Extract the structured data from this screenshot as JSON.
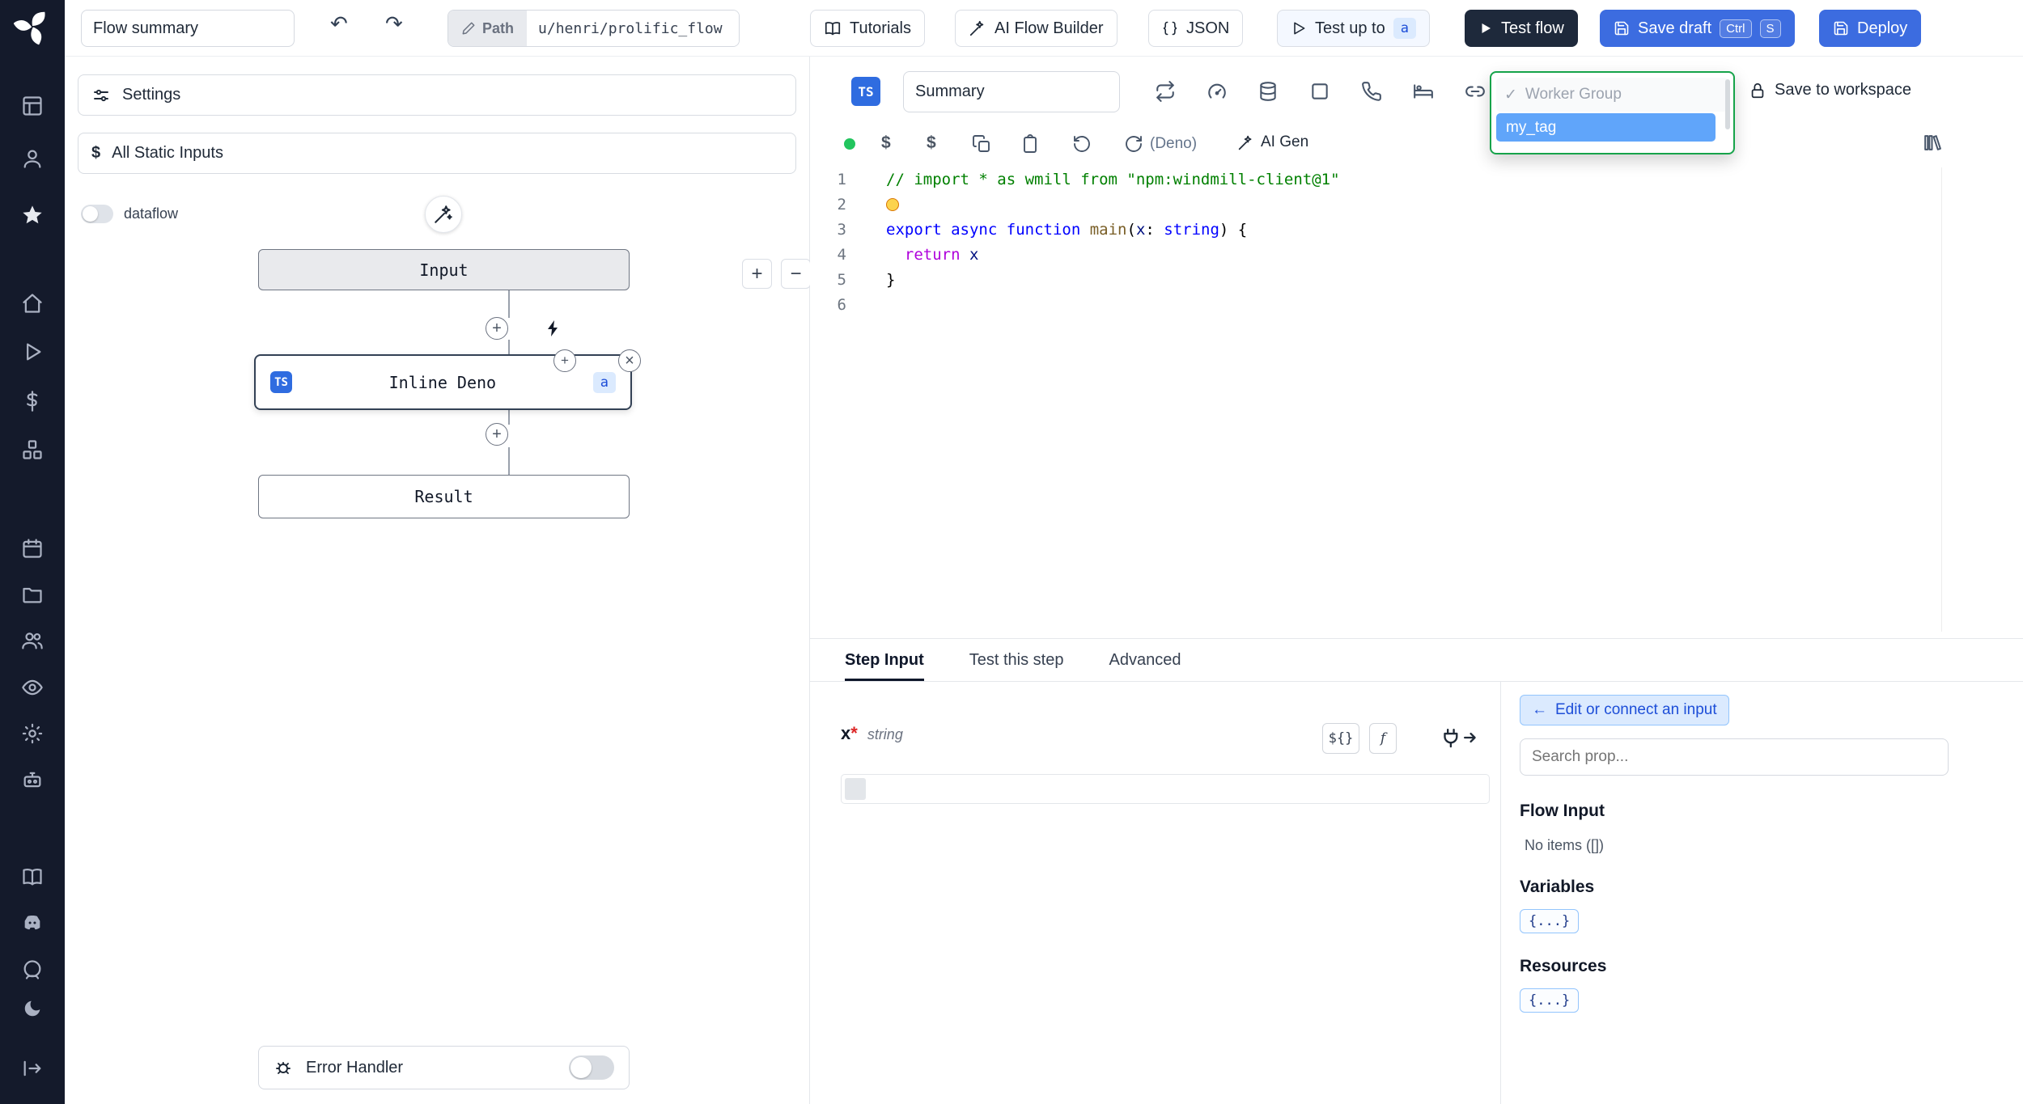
{
  "colors": {
    "sidebar_bg": "#141a2b",
    "accent_blue": "#3c6ce0",
    "dark_button": "#1e293b",
    "dropdown_border": "#16a34a",
    "selected_tag_bg": "#60a5fa",
    "ts_badge_bg": "#2f6ce0"
  },
  "icons": {
    "undo": "↶",
    "redo": "↷",
    "zoom_in": "+",
    "zoom_out": "−",
    "close": "×",
    "check": "✓",
    "arrow_left": "←",
    "dollar": "$",
    "plus": "+"
  },
  "topbar": {
    "flow_summary": "Flow summary",
    "path_label": "Path",
    "path_value": "u/henri/prolific_flow",
    "tutorials": "Tutorials",
    "ai_flow_builder": "AI Flow Builder",
    "json": "JSON",
    "test_up_to": "Test up to",
    "test_up_to_step": "a",
    "test_flow": "Test flow",
    "save_draft": "Save draft",
    "kbd_ctrl": "Ctrl",
    "kbd_s": "S",
    "deploy": "Deploy"
  },
  "flow_panel": {
    "settings": "Settings",
    "all_static_inputs": "All Static Inputs",
    "dataflow": "dataflow",
    "input_node": "Input",
    "step_node": "Inline Deno",
    "step_node_lang": "TS",
    "step_node_id": "a",
    "result_node": "Result",
    "error_handler": "Error Handler"
  },
  "editor": {
    "lang_badge": "TS",
    "summary": "Summary",
    "dropdown": {
      "header": "Worker Group",
      "selected": "my_tag"
    },
    "save_to_workspace": "Save to workspace",
    "lang_note": "(Deno)",
    "ai_gen": "AI Gen",
    "code_lines": [
      {
        "n": "1",
        "t": [
          [
            "// import * as wmill from \"npm:windmill-client@1\"",
            "comment"
          ]
        ]
      },
      {
        "n": "2",
        "t": [
          [
            "",
            "bulb"
          ]
        ]
      },
      {
        "n": "3",
        "t": [
          [
            "export",
            "kw"
          ],
          [
            " ",
            ""
          ],
          [
            "async",
            "kw"
          ],
          [
            " ",
            ""
          ],
          [
            "function",
            "kw"
          ],
          [
            " ",
            ""
          ],
          [
            "main",
            "fn"
          ],
          [
            "(",
            ""
          ],
          [
            "x",
            "param"
          ],
          [
            ": ",
            ""
          ],
          [
            "string",
            "type"
          ],
          [
            ") {",
            ""
          ]
        ]
      },
      {
        "n": "4",
        "t": [
          [
            "  ",
            ""
          ],
          [
            "return",
            "ctrl"
          ],
          [
            " ",
            ""
          ],
          [
            "x",
            "param"
          ]
        ]
      },
      {
        "n": "5",
        "t": [
          [
            "}",
            ""
          ]
        ]
      },
      {
        "n": "6",
        "t": []
      }
    ]
  },
  "step_panel": {
    "tabs": [
      "Step Input",
      "Test this step",
      "Advanced"
    ],
    "arg": {
      "name": "x",
      "required": "*",
      "type": "string"
    },
    "dollar_brace_badge": "${}",
    "fn_badge": "f",
    "connect_button": "Edit or connect an input",
    "search_placeholder": "Search prop...",
    "flow_input_title": "Flow Input",
    "flow_input_empty": "No items ([])",
    "variables_title": "Variables",
    "variables_badge": "{...}",
    "resources_title": "Resources",
    "resources_badge": "{...}"
  }
}
